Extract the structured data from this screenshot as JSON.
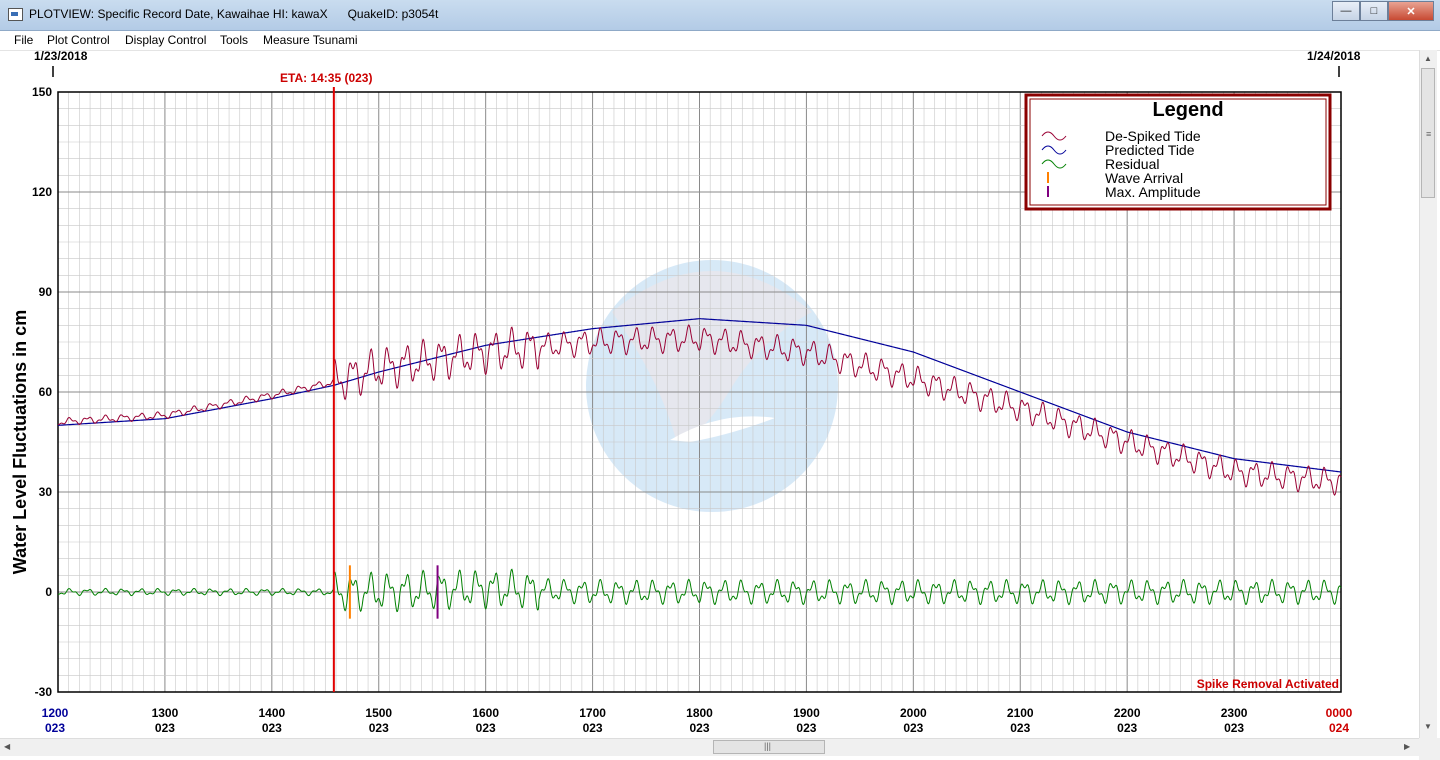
{
  "window": {
    "title": "PLOTVIEW: Specific Record Date, Kawaihae HI: kawaX      QuakeID: p3054t",
    "minimize_icon": "minimize-icon",
    "maximize_icon": "maximize-icon",
    "close_icon": "close-icon"
  },
  "menu": {
    "items": [
      "File",
      "Plot Control",
      "Display Control",
      "Tools",
      "Measure Tsunami"
    ]
  },
  "plot": {
    "date_left": "1/23/2018",
    "date_right": "1/24/2018",
    "eta_label": "ETA: 14:35 (023)",
    "ylabel": "Water Level Fluctuations in cm",
    "status": "Spike Removal Activated",
    "yticks": [
      "150",
      "120",
      "90",
      "60",
      "30",
      "0",
      "-30"
    ],
    "xticks": [
      {
        "time": "1200",
        "day": "023"
      },
      {
        "time": "1300",
        "day": "023"
      },
      {
        "time": "1400",
        "day": "023"
      },
      {
        "time": "1500",
        "day": "023"
      },
      {
        "time": "1600",
        "day": "023"
      },
      {
        "time": "1700",
        "day": "023"
      },
      {
        "time": "1800",
        "day": "023"
      },
      {
        "time": "1900",
        "day": "023"
      },
      {
        "time": "2000",
        "day": "023"
      },
      {
        "time": "2100",
        "day": "023"
      },
      {
        "time": "2200",
        "day": "023"
      },
      {
        "time": "2300",
        "day": "023"
      },
      {
        "time": "0000",
        "day": "024"
      }
    ],
    "legend": {
      "title": "Legend",
      "items": [
        {
          "label": "De-Spiked Tide",
          "color": "#990033"
        },
        {
          "label": "Predicted Tide",
          "color": "#000099"
        },
        {
          "label": "Residual",
          "color": "#008000"
        },
        {
          "label": "Wave Arrival",
          "color": "#ff8000"
        },
        {
          "label": "Max. Amplitude",
          "color": "#800080"
        }
      ]
    },
    "watermark_logo": "noaa-logo",
    "colors": {
      "eta_line": "#e00000",
      "grid": "#a9a9a9",
      "legend_border": "#8b0000",
      "first_tick": "#000099",
      "last_tick": "#cc0000"
    }
  },
  "chart_data": {
    "type": "line",
    "x_unit": "hours of day 023 (1200 to 2400)",
    "ylim": [
      -30,
      150
    ],
    "xlim": [
      12,
      24
    ],
    "eta": 14.58,
    "wave_arrival": 14.73,
    "max_amplitude": 15.55,
    "series": [
      {
        "name": "Predicted Tide",
        "x": [
          12,
          13,
          14,
          14.58,
          15,
          16,
          17,
          18,
          19,
          20,
          21,
          22,
          23,
          24
        ],
        "y": [
          50,
          52,
          58,
          62,
          66,
          74,
          79,
          82,
          80,
          72,
          60,
          48,
          40,
          36
        ]
      },
      {
        "name": "De-Spiked Tide",
        "x": [
          12,
          13,
          14,
          14.58,
          15,
          16,
          17,
          18,
          19,
          20,
          21,
          22,
          23,
          24
        ],
        "y": [
          51,
          53,
          59,
          63,
          67,
          72,
          75,
          76,
          72,
          64,
          55,
          45,
          36,
          33
        ]
      },
      {
        "name": "Residual",
        "x": [
          12,
          13,
          14,
          15,
          16,
          17,
          18,
          19,
          20,
          21,
          22,
          23,
          24
        ],
        "y": [
          0,
          0,
          0,
          0,
          1,
          0,
          0,
          0,
          0,
          0,
          0,
          0,
          0
        ]
      }
    ]
  }
}
